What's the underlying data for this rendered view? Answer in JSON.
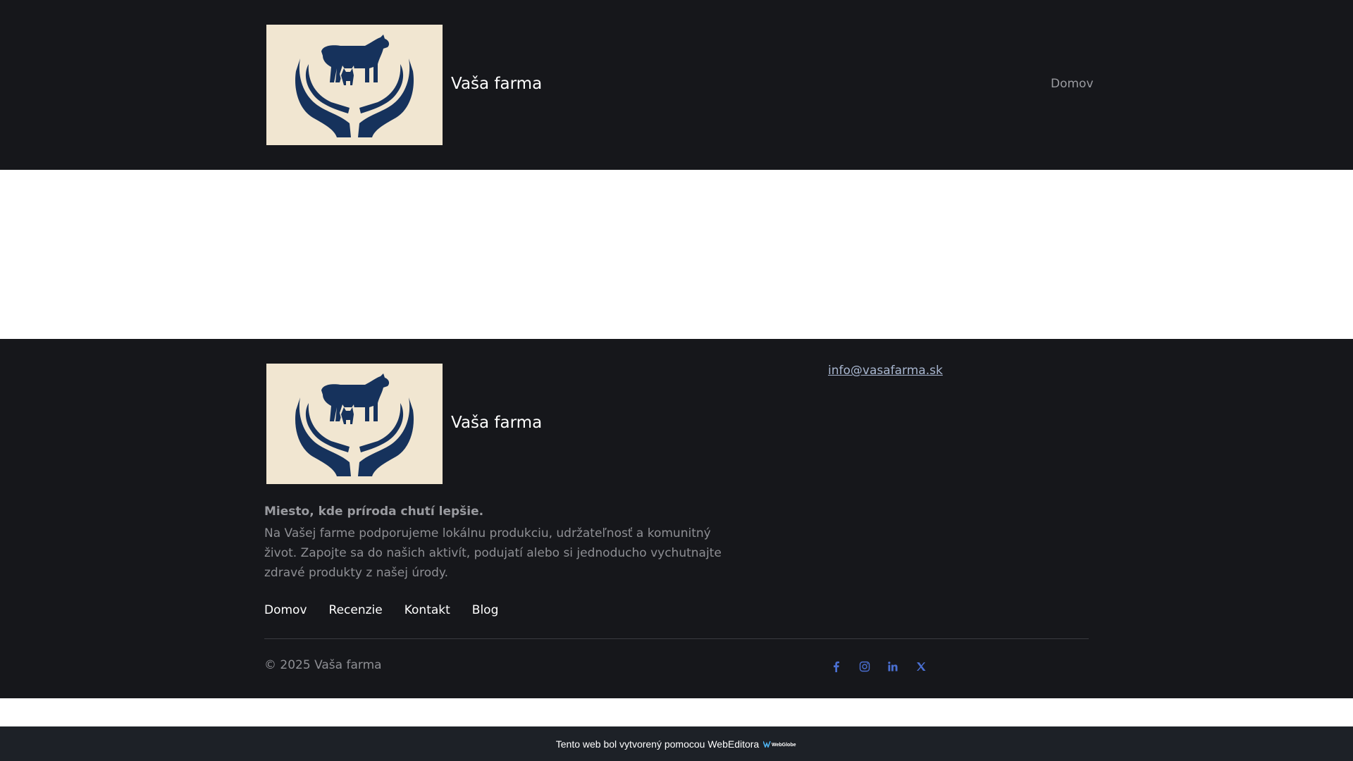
{
  "header": {
    "site_name": "Vaša farma",
    "nav": [
      "Domov"
    ]
  },
  "footer": {
    "site_name": "Vaša farma",
    "email": "info@vasafarma.sk",
    "tagline": "Miesto, kde príroda chutí lepšie.",
    "description": "Na Vašej farme podporujeme lokálnu produkciu, udržateľnosť a komunitný život. Zapojte sa do našich aktivít, podujatí alebo si jednoducho vychutnajte zdravé produkty z našej úrody.",
    "nav": [
      "Domov",
      "Recenzie",
      "Kontakt",
      "Blog"
    ],
    "copyright": "© 2025 Vaša farma",
    "social_icons": [
      "facebook-icon",
      "instagram-icon",
      "linkedin-icon",
      "x-icon"
    ]
  },
  "badge": {
    "text": "Tento web bol vytvorený pomocou WebEditora",
    "logo_text": "WebGlobe"
  },
  "colors": {
    "dark_bg": "#16171b",
    "logo_bg": "#f1e6d1",
    "logo_fg": "#16325c",
    "link": "#a8b6cf",
    "social": "#4a6fd1"
  }
}
